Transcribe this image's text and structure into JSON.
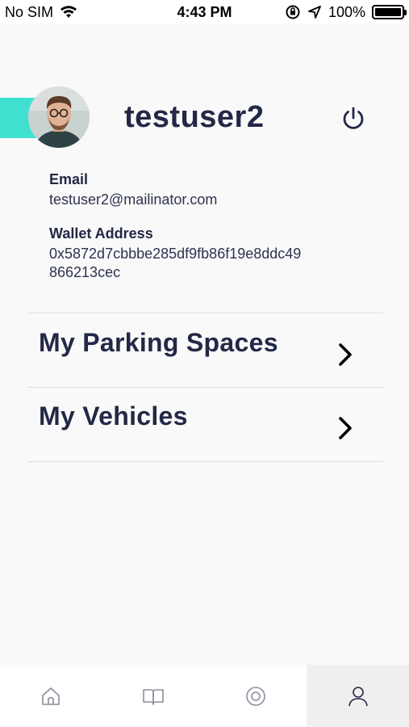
{
  "status_bar": {
    "carrier": "No SIM",
    "time": "4:43 PM",
    "battery": "100%",
    "battery_level": 1.0
  },
  "profile": {
    "username": "testuser2",
    "email_label": "Email",
    "email": "testuser2@mailinator.com",
    "wallet_label": "Wallet Address",
    "wallet_line1": "0x5872d7cbbbe285df9fb86f19e8ddc49",
    "wallet_line2": "866213cec"
  },
  "menu": {
    "items": [
      {
        "label": "My Parking Spaces"
      },
      {
        "label": "My Vehicles"
      }
    ]
  },
  "tab_bar": {
    "tabs": [
      {
        "icon": "home-icon"
      },
      {
        "icon": "book-icon"
      },
      {
        "icon": "target-icon"
      },
      {
        "icon": "user-icon",
        "active": true
      }
    ]
  },
  "colors": {
    "accent": "#3fe0d0",
    "text": "#232846"
  }
}
